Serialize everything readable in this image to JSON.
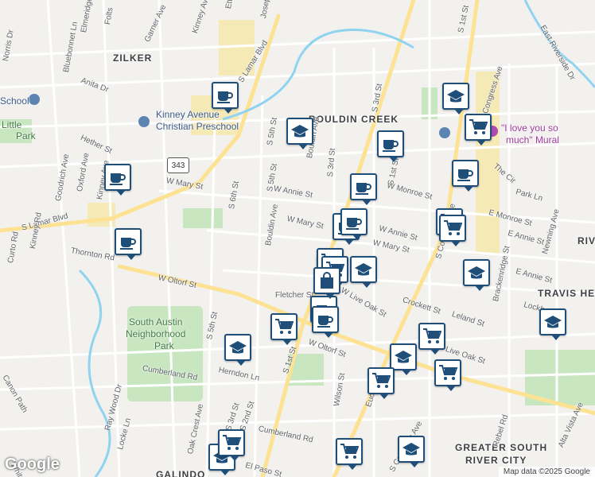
{
  "map": {
    "areas": [
      {
        "id": "zilker",
        "text": "ZILKER"
      },
      {
        "id": "bouldin",
        "text": "BOULDIN CREEK"
      },
      {
        "id": "travis",
        "text": "TRAVIS HE"
      },
      {
        "id": "gsrc",
        "text": "GREATER SOUTH"
      },
      {
        "id": "gsrc2",
        "text": "RIVER CITY"
      },
      {
        "id": "galindo",
        "text": "GALINDO"
      },
      {
        "id": "riv",
        "text": "RIV"
      }
    ],
    "streets": [
      {
        "id": "s1",
        "text": "W Mary St"
      },
      {
        "id": "s2",
        "text": "S 6th St"
      },
      {
        "id": "s3",
        "text": "S 5th St"
      },
      {
        "id": "s4",
        "text": "W Annie St"
      },
      {
        "id": "s5",
        "text": "Bouldin Ave"
      },
      {
        "id": "s6",
        "text": "W Mary St"
      },
      {
        "id": "s7",
        "text": "W Oltorf St"
      },
      {
        "id": "s8",
        "text": "S Lamar Blvd"
      },
      {
        "id": "s9",
        "text": "S Lamar Blvd"
      },
      {
        "id": "s10",
        "text": "Thornton Rd"
      },
      {
        "id": "s11",
        "text": "Kinney Rd"
      },
      {
        "id": "s12",
        "text": "Goodrich Ave"
      },
      {
        "id": "s13",
        "text": "Oxford Ave"
      },
      {
        "id": "s14",
        "text": "Hether St"
      },
      {
        "id": "s15",
        "text": "Bluebonnet Ln"
      },
      {
        "id": "s16",
        "text": "Garner Ave"
      },
      {
        "id": "s17",
        "text": "Kinney Ave"
      },
      {
        "id": "s18",
        "text": "Folts"
      },
      {
        "id": "s19",
        "text": "Anita Dr"
      },
      {
        "id": "s20",
        "text": "Norris Dr"
      },
      {
        "id": "s21",
        "text": "S 5th St"
      },
      {
        "id": "s22",
        "text": "S 3rd St"
      },
      {
        "id": "s23",
        "text": "S 1st St"
      },
      {
        "id": "s24",
        "text": "W Monroe St"
      },
      {
        "id": "s25",
        "text": "W Annie St"
      },
      {
        "id": "s26",
        "text": "W Mary St"
      },
      {
        "id": "s27",
        "text": "Crockett St"
      },
      {
        "id": "s28",
        "text": "Leland St"
      },
      {
        "id": "s29",
        "text": "W Live Oak St"
      },
      {
        "id": "s30",
        "text": "Fletcher St"
      },
      {
        "id": "s31",
        "text": "W Oltorf St"
      },
      {
        "id": "s32",
        "text": "S 1st St"
      },
      {
        "id": "s33",
        "text": "Wilson St"
      },
      {
        "id": "s34",
        "text": "Euclid Ave"
      },
      {
        "id": "s35",
        "text": "S Congress Ave"
      },
      {
        "id": "s36",
        "text": "S Congress Ave"
      },
      {
        "id": "s37",
        "text": "S 1st St"
      },
      {
        "id": "s38",
        "text": "East Riverside Dr"
      },
      {
        "id": "s39",
        "text": "E Monroe St"
      },
      {
        "id": "s40",
        "text": "Park Ln"
      },
      {
        "id": "s41",
        "text": "The Cir"
      },
      {
        "id": "s42",
        "text": "Newning Ave"
      },
      {
        "id": "s43",
        "text": "Brackenridge St"
      },
      {
        "id": "s44",
        "text": "E Annie St"
      },
      {
        "id": "s45",
        "text": "Lockhart Dr"
      },
      {
        "id": "s46",
        "text": "Alta Vista Ave"
      },
      {
        "id": "s47",
        "text": "Rebel Rd"
      },
      {
        "id": "s48",
        "text": "Live Oak St"
      },
      {
        "id": "s49",
        "text": "Cumberland Rd"
      },
      {
        "id": "s50",
        "text": "Cumberland Rd"
      },
      {
        "id": "s51",
        "text": "Herndon Ln"
      },
      {
        "id": "s52",
        "text": "S 3rd St"
      },
      {
        "id": "s53",
        "text": "S 2nd St"
      },
      {
        "id": "s54",
        "text": "Oak Crest Ave"
      },
      {
        "id": "s55",
        "text": "S 5th St"
      },
      {
        "id": "s56",
        "text": "Ray Wood Dr"
      },
      {
        "id": "s57",
        "text": "Locke Ln"
      },
      {
        "id": "s58",
        "text": "El Paso St"
      },
      {
        "id": "s59",
        "text": "Joseph"
      },
      {
        "id": "s60",
        "text": "Kinney Ave"
      },
      {
        "id": "s61",
        "text": "Elmeridge Pl"
      },
      {
        "id": "s62",
        "text": "Etta"
      },
      {
        "id": "s63",
        "text": "Curto Rd"
      },
      {
        "id": "s64",
        "text": "Whitsey Rd"
      },
      {
        "id": "s65",
        "text": "Canon Path"
      },
      {
        "id": "s66",
        "text": "Bouldin Ave"
      },
      {
        "id": "s67",
        "text": "S 3rd St"
      },
      {
        "id": "s68",
        "text": "S Congress Ave"
      },
      {
        "id": "s69",
        "text": "E Annie St"
      }
    ],
    "pois": [
      {
        "id": "p1",
        "text": "Kinney Avenue"
      },
      {
        "id": "p2",
        "text": "Christian Preschool"
      },
      {
        "id": "p3",
        "text": "South Austin"
      },
      {
        "id": "p4",
        "text": "Neighborhood"
      },
      {
        "id": "p5",
        "text": "Park"
      },
      {
        "id": "p6",
        "text": "\"I love you so"
      },
      {
        "id": "p7",
        "text": "much\" Mural"
      },
      {
        "id": "p8",
        "text": "Little"
      },
      {
        "id": "p9",
        "text": "Park"
      },
      {
        "id": "p10",
        "text": "School"
      }
    ],
    "route_shield": "343",
    "markers": [
      {
        "type": "coffee"
      },
      {
        "type": "coffee"
      },
      {
        "type": "coffee"
      },
      {
        "type": "coffee"
      },
      {
        "type": "coffee"
      },
      {
        "type": "coffee"
      },
      {
        "type": "coffee"
      },
      {
        "type": "coffee"
      },
      {
        "type": "coffee"
      },
      {
        "type": "coffee"
      },
      {
        "type": "coffee"
      },
      {
        "type": "school"
      },
      {
        "type": "school"
      },
      {
        "type": "school"
      },
      {
        "type": "school"
      },
      {
        "type": "school"
      },
      {
        "type": "school"
      },
      {
        "type": "school"
      },
      {
        "type": "school"
      },
      {
        "type": "school"
      },
      {
        "type": "cart"
      },
      {
        "type": "cart"
      },
      {
        "type": "cart"
      },
      {
        "type": "cart"
      },
      {
        "type": "cart"
      },
      {
        "type": "cart"
      },
      {
        "type": "cart"
      },
      {
        "type": "cart"
      },
      {
        "type": "cart"
      },
      {
        "type": "cart"
      },
      {
        "type": "cart"
      },
      {
        "type": "bag"
      }
    ],
    "logo": "Google",
    "attribution": "Map data ©2025 Google",
    "colors": {
      "marker_border": "#1f4e79",
      "water": "#8fd3f0",
      "park": "#c8e6c0",
      "highway": "#f7e4a8"
    }
  }
}
